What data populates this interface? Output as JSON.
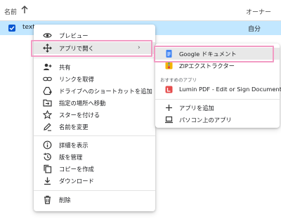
{
  "list": {
    "column_name": "名前",
    "column_owner": "オーナー",
    "selected_file": {
      "name": "text",
      "owner": "自分"
    }
  },
  "context_menu": {
    "items": [
      {
        "label": "プレビュー",
        "icon": "eye-icon"
      },
      {
        "label": "アプリで開く",
        "icon": "move-arrows-icon",
        "submenu_arrow": "›"
      },
      {
        "label": "共有",
        "icon": "person-add-icon"
      },
      {
        "label": "リンクを取得",
        "icon": "link-icon"
      },
      {
        "label": "ドライブへのショートカットを追加",
        "icon": "drive-shortcut-icon"
      },
      {
        "label": "指定の場所へ移動",
        "icon": "folder-move-icon"
      },
      {
        "label": "スターを付ける",
        "icon": "star-icon"
      },
      {
        "label": "名前を変更",
        "icon": "pencil-icon"
      },
      {
        "label": "詳細を表示",
        "icon": "info-icon"
      },
      {
        "label": "版を管理",
        "icon": "history-icon"
      },
      {
        "label": "コピーを作成",
        "icon": "copy-icon"
      },
      {
        "label": "ダウンロード",
        "icon": "download-icon"
      },
      {
        "label": "削除",
        "icon": "trash-icon"
      }
    ]
  },
  "open_with_menu": {
    "items": [
      {
        "label": "Google ドキュメント",
        "icon": "google-docs-icon",
        "color": "#4285f4"
      },
      {
        "label": "ZIPエクストラクター",
        "icon": "zip-extractor-icon",
        "color": "#f4b400"
      }
    ],
    "suggested_heading": "おすすめのアプリ",
    "suggested": [
      {
        "label": "Lumin PDF - Edit or Sign Documents",
        "icon": "lumin-pdf-icon",
        "color": "#e54c4c"
      }
    ],
    "add_app": "アプリを追加",
    "desktop_app": "パソコン上のアプリ"
  },
  "colors": {
    "selected_row": "#c2e7ff",
    "hover_item": "#e8e8e8",
    "highlight_frame": "#f29cc4",
    "checkbox": "#0b57d0"
  }
}
